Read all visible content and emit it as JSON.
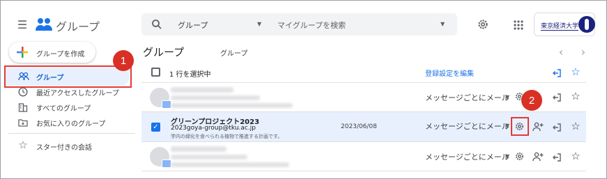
{
  "app": {
    "title": "グループ"
  },
  "search": {
    "scope": "グループ",
    "placeholder": "マイグループを検索"
  },
  "brand": {
    "name": "東京経済大学"
  },
  "sidebar": {
    "create_label": "グループを作成",
    "items": [
      {
        "label": "グループ"
      },
      {
        "label": "最近アクセスしたグループ"
      },
      {
        "label": "すべてのグループ"
      },
      {
        "label": "お気に入りのグループ"
      },
      {
        "label": "スター付きの会話"
      }
    ]
  },
  "main": {
    "heading": "グループ",
    "subheading": "グループ",
    "selection_text": "1 行を選択中",
    "edit_registration": "登録設定を編集",
    "rows": [
      {
        "selected": false,
        "title": "",
        "email": "",
        "description": "",
        "date": "",
        "delivery": "メッセージごとにメール"
      },
      {
        "selected": true,
        "title": "グリーンプロジェクト2023",
        "email": "2023goya-group@tku.ac.jp",
        "description": "学内の緑化を食べられる植物で推進する計画です。",
        "date": "2023/06/08",
        "delivery": "メッセージごとにメール"
      },
      {
        "selected": false,
        "title": "",
        "email": "",
        "description": "",
        "date": "",
        "delivery": "メッセージごとにメール"
      }
    ]
  },
  "annotations": {
    "badge1": "1",
    "badge2": "2"
  },
  "colors": {
    "accent": "#1a73e8",
    "highlight": "#e53935",
    "selected_row": "#e8f0fe"
  },
  "icons": [
    "menu-icon",
    "groups-icon",
    "search-icon",
    "settings-icon",
    "apps-icon",
    "plus-icon",
    "people-icon",
    "clock-icon",
    "building-icon",
    "folder-star-icon",
    "star-icon",
    "chevron-left-icon",
    "chevron-right-icon",
    "leave-icon",
    "add-person-icon"
  ]
}
